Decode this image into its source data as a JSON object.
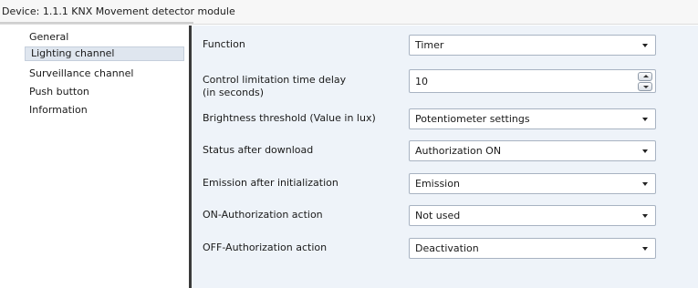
{
  "header": {
    "device_title": "Device: 1.1.1  KNX Movement detector module"
  },
  "sidebar": {
    "items": [
      {
        "label": "General",
        "selected": false
      },
      {
        "label": "Lighting channel",
        "selected": true
      },
      {
        "label": "Surveillance channel",
        "selected": false
      },
      {
        "label": "Push button",
        "selected": false
      },
      {
        "label": "Information",
        "selected": false
      }
    ]
  },
  "parameters": {
    "function": {
      "label": "Function",
      "value": "Timer"
    },
    "control_limitation": {
      "label_line1": "Control limitation time delay",
      "label_line2": "(in seconds)",
      "value": "10"
    },
    "brightness_threshold": {
      "label": "Brightness threshold (Value in lux)",
      "value": "Potentiometer settings"
    },
    "status_after_download": {
      "label": "Status after download",
      "value": "Authorization ON"
    },
    "emission_after_init": {
      "label": "Emission after initialization",
      "value": "Emission"
    },
    "on_authorization": {
      "label": "ON-Authorization action",
      "value": "Not used"
    },
    "off_authorization": {
      "label": "OFF-Authorization action",
      "value": "Deactivation"
    }
  },
  "icons": {
    "dropdown": "chevron-down-icon",
    "spin_up": "spin-up-icon",
    "spin_down": "spin-down-icon"
  },
  "colors": {
    "content_background": "#eef3f9",
    "selected_item_background": "#dfe6ef",
    "divider": "#3a3a3a"
  }
}
